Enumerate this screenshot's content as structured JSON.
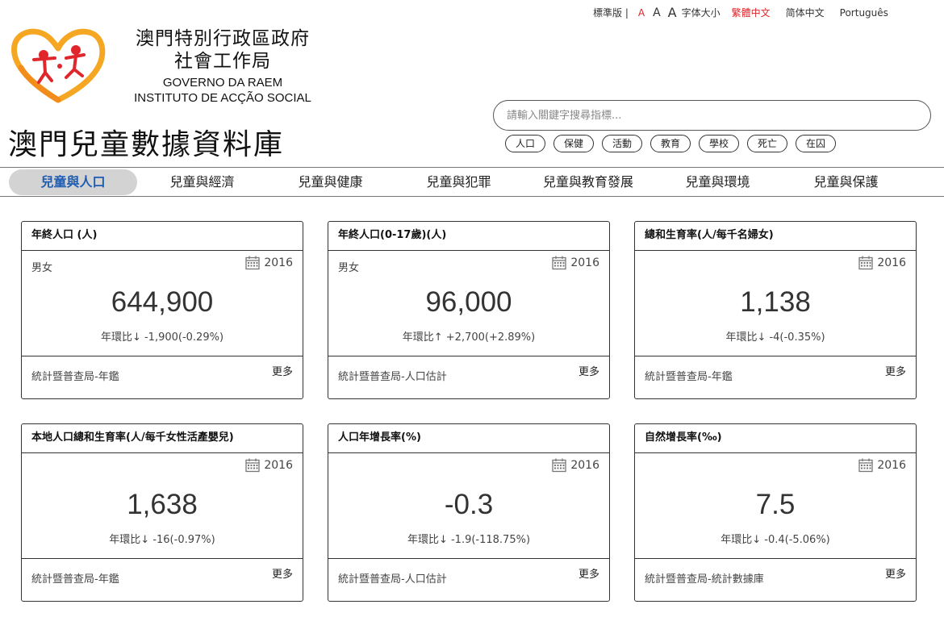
{
  "topbar": {
    "standard": "標準版 |",
    "font_a_small": "A",
    "font_a_mid": "A",
    "font_a_large": "A",
    "font_size_label": "字体大小",
    "lang_trad": "繁體中文",
    "lang_simp": "简体中文",
    "lang_pt": "Português"
  },
  "org": {
    "name_zh_line1": "澳門特別行政區政府",
    "name_zh_line2": "社會工作局",
    "name_pt_line1": "GOVERNO DA RAEM",
    "name_pt_line2": "INSTITUTO DE ACÇÃO SOCIAL"
  },
  "site_title": "澳門兒童數據資料庫",
  "search": {
    "placeholder": "請輸入關鍵字搜尋指標..."
  },
  "tags": [
    "人口",
    "保健",
    "活動",
    "教育",
    "學校",
    "死亡",
    "在囚"
  ],
  "nav": {
    "items": [
      "兒童與人口",
      "兒童與經濟",
      "兒童與健康",
      "兒童與犯罪",
      "兒童與教育發展",
      "兒童與環境",
      "兒童與保護"
    ],
    "active": "兒童與人口"
  },
  "colors": {
    "accent_red": "#e0262b",
    "nav_active_text": "#1d5cb5",
    "nav_active_bg": "#d3d3d3",
    "logo_orange": "#f5a623"
  },
  "cards": [
    {
      "title": "年終人口 (人)",
      "sex": "男女",
      "year": "2016",
      "value": "644,900",
      "change": "年環比↓ -1,900(-0.29%)",
      "source": "統計暨普查局-年鑑",
      "more": "更多"
    },
    {
      "title": "年終人口(0-17歲)(人)",
      "sex": "男女",
      "year": "2016",
      "value": "96,000",
      "change": "年環比↑ +2,700(+2.89%)",
      "source": "統計暨普查局-人口估計",
      "more": "更多"
    },
    {
      "title": "總和生育率(人/每千名婦女)",
      "sex": "",
      "year": "2016",
      "value": "1,138",
      "change": "年環比↓ -4(-0.35%)",
      "source": "統計暨普查局-年鑑",
      "more": "更多"
    },
    {
      "title": "本地人口總和生育率(人/每千女性活產嬰兒)",
      "sex": "",
      "year": "2016",
      "value": "1,638",
      "change": "年環比↓ -16(-0.97%)",
      "source": "統計暨普查局-年鑑",
      "more": "更多"
    },
    {
      "title": "人口年增長率(%)",
      "sex": "",
      "year": "2016",
      "value": "-0.3",
      "change": "年環比↓ -1.9(-118.75%)",
      "source": "統計暨普查局-人口估計",
      "more": "更多"
    },
    {
      "title": "自然增長率(‰)",
      "sex": "",
      "year": "2016",
      "value": "7.5",
      "change": "年環比↓ -0.4(-5.06%)",
      "source": "統計暨普查局-統計數據庫",
      "more": "更多"
    }
  ]
}
